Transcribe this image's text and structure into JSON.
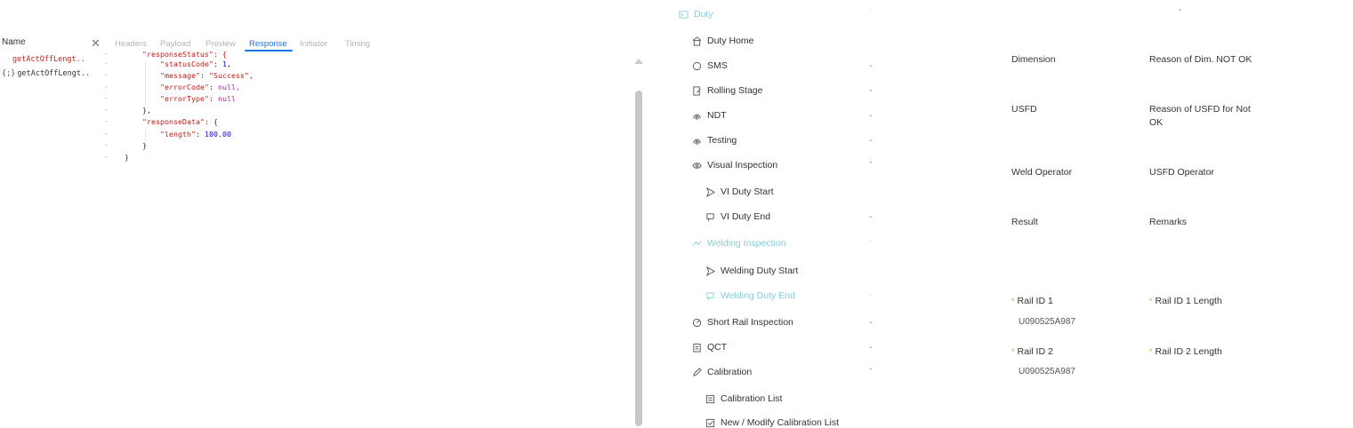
{
  "devtools": {
    "name_header": "Name",
    "close_glyph": "✕",
    "requests": [
      {
        "name": "getActOffLengt..",
        "icon": ""
      },
      {
        "name": "getActOffLengt..",
        "icon": "{;}"
      }
    ],
    "tabs": [
      "Headers",
      "Payload",
      "Preview",
      "Response",
      "Initiator",
      "Timing"
    ],
    "active_tab": "Response",
    "response_lines": [
      {
        "prefix": "\"responseStatus\": {",
        "indent": 2
      },
      {
        "key": "\"statusCode\"",
        "val": "1,",
        "vtype": "num",
        "indent": 3
      },
      {
        "key": "\"message\"",
        "val": "\"Success\",",
        "vtype": "str",
        "indent": 3
      },
      {
        "key": "\"errorCode\"",
        "val": "null,",
        "vtype": "null",
        "indent": 3
      },
      {
        "key": "\"errorType\"",
        "val": "null",
        "vtype": "null",
        "indent": 3
      },
      {
        "plain": "},",
        "indent": 2
      },
      {
        "key": "\"responseData\"",
        "val": "{",
        "vtype": "plain",
        "indent": 2
      },
      {
        "key": "\"length\"",
        "val": "100.00",
        "vtype": "num",
        "indent": 3
      },
      {
        "plain": "}",
        "indent": 2
      },
      {
        "plain": "}",
        "indent": 1
      }
    ]
  },
  "sidebar": {
    "header": {
      "label": "Duty",
      "icon": "duty-icon"
    },
    "items": [
      {
        "label": "Duty Home",
        "icon": "home-icon",
        "chevron": ""
      },
      {
        "label": "SMS",
        "icon": "circle-icon",
        "chevron": "⌄"
      },
      {
        "label": "Rolling Stage",
        "icon": "document-edit-icon",
        "chevron": "⌄"
      },
      {
        "label": "NDT",
        "icon": "fingerprint-icon",
        "chevron": "⌄"
      },
      {
        "label": "Testing",
        "icon": "fingerprint-icon",
        "chevron": "⌄"
      },
      {
        "label": "Visual Inspection",
        "icon": "eye-icon",
        "chevron": "⌃"
      },
      {
        "label": "VI Duty Start",
        "icon": "send-icon",
        "chevron": ""
      },
      {
        "label": "VI Duty End",
        "icon": "flag-icon",
        "chevron": "⌄"
      },
      {
        "label": "Welding Inspection",
        "icon": "welding-icon",
        "chevron": "⌃"
      },
      {
        "label": "Welding Duty Start",
        "icon": "send-icon",
        "chevron": ""
      },
      {
        "label": "Welding Duty End",
        "icon": "flag-icon",
        "chevron": "⌄"
      },
      {
        "label": "Short Rail Inspection",
        "icon": "gauge-icon",
        "chevron": "⌄"
      },
      {
        "label": "QCT",
        "icon": "clipboard-icon",
        "chevron": "⌄"
      },
      {
        "label": "Calibration",
        "icon": "pencil-icon",
        "chevron": "⌃"
      },
      {
        "label": "Calibration List",
        "icon": "list-icon",
        "chevron": ""
      },
      {
        "label": "New / Modify Calibration List",
        "icon": "checklist-icon",
        "chevron": ""
      }
    ],
    "header_chevron": "⌃"
  },
  "form": {
    "top_mark": "-",
    "dimension": "Dimension",
    "reason_dim": "Reason of Dim. NOT OK",
    "usfd": "USFD",
    "reason_usfd_1": "Reason of USFD for Not",
    "reason_usfd_2": "OK",
    "weld_operator": "Weld Operator",
    "usfd_operator": "USFD Operator",
    "result": "Result",
    "remarks": "Remarks",
    "rail_id_1": "Rail ID 1",
    "rail_id_1_length": "Rail ID 1 Length",
    "rail_id_1_value": "U090525A987",
    "rail_id_2": "Rail ID 2",
    "rail_id_2_length": "Rail ID 2 Length",
    "rail_id_2_value": "U090525A987",
    "required_mark": "*"
  }
}
